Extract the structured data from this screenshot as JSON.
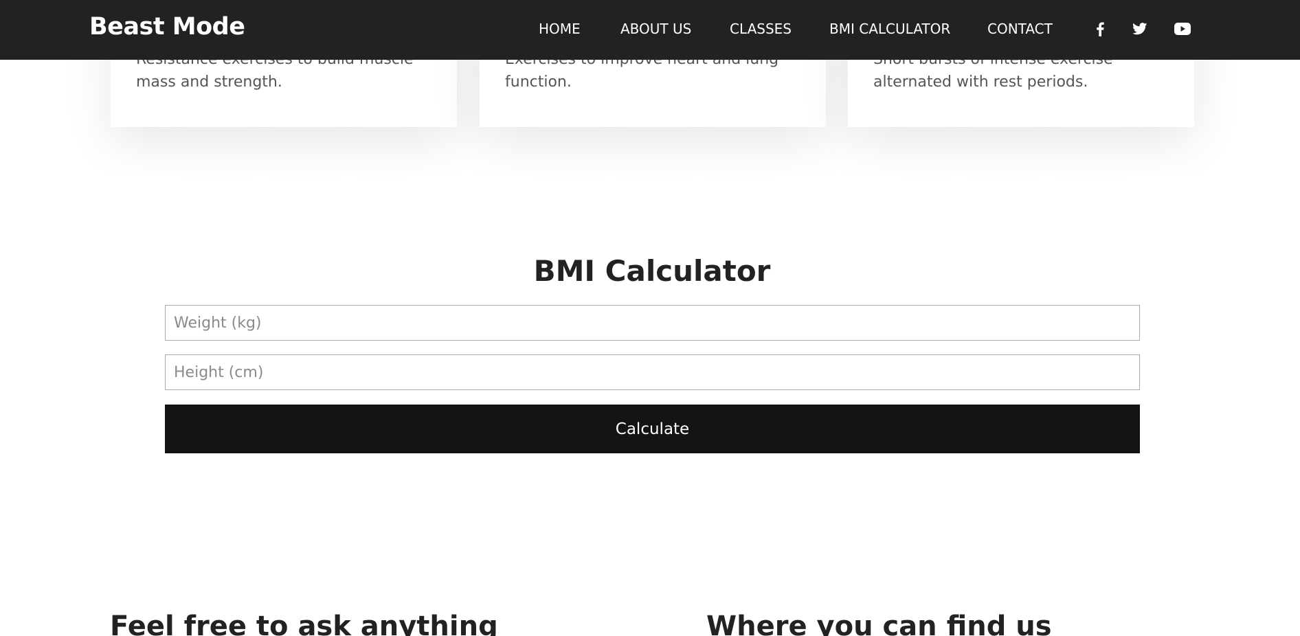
{
  "brand": {
    "name": "Beast Mode"
  },
  "nav": {
    "items": [
      {
        "label": "HOME"
      },
      {
        "label": "ABOUT US"
      },
      {
        "label": "CLASSES"
      },
      {
        "label": "BMI CALCULATOR"
      },
      {
        "label": "CONTACT"
      }
    ],
    "social": [
      {
        "icon": "facebook-icon"
      },
      {
        "icon": "twitter-icon"
      },
      {
        "icon": "youtube-icon"
      }
    ]
  },
  "classes": {
    "cards": [
      {
        "text": "Resistance exercises to build muscle mass and strength."
      },
      {
        "text": "Exercises to improve heart and lung function."
      },
      {
        "text": "Short bursts of intense exercise alternated with rest periods."
      }
    ]
  },
  "bmi": {
    "title": "BMI Calculator",
    "weight_placeholder": "Weight (kg)",
    "height_placeholder": "Height (cm)",
    "weight_value": "",
    "height_value": "",
    "button_label": "Calculate"
  },
  "contact": {
    "ask_heading": "Feel free to ask anything",
    "find_heading": "Where you can find us"
  },
  "colors": {
    "navbar_bg": "#222222",
    "button_bg": "#141414",
    "text_dark": "#222222",
    "text_muted": "#555555"
  }
}
